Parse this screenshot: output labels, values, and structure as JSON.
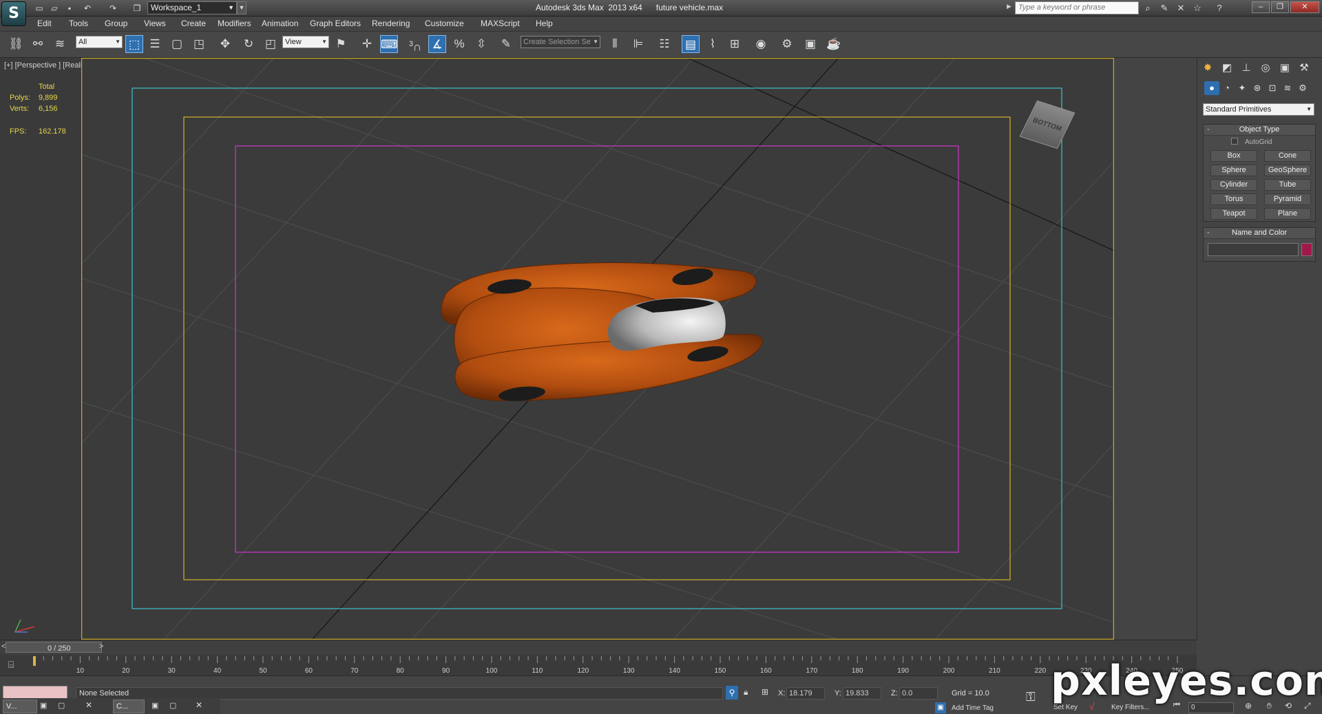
{
  "titlebar": {
    "workspace": "Workspace_1",
    "app_title": "Autodesk 3ds Max  2013 x64",
    "file_name": "future vehicle.max",
    "search_placeholder": "Type a keyword or phrase"
  },
  "menu": [
    "Edit",
    "Tools",
    "Group",
    "Views",
    "Create",
    "Modifiers",
    "Animation",
    "Graph Editors",
    "Rendering",
    "Customize",
    "MAXScript",
    "Help"
  ],
  "toolbar": {
    "selection_filter": "All",
    "reference_coord": "View",
    "named_selection": "Create Selection Se",
    "snap_3d": "3"
  },
  "viewport": {
    "label": "[+] [Perspective ] [Realistic ]",
    "stats": {
      "header": "Total",
      "polys_label": "Polys:",
      "polys": "9,899",
      "verts_label": "Verts:",
      "verts": "6,156",
      "fps_label": "FPS:",
      "fps": "162.178"
    },
    "viewcube_label": "BOTTOM",
    "colors": {
      "safe_outer": "#c7a92a",
      "safe_action": "#3fb7c4",
      "safe_title": "#c7a92a",
      "safe_inner": "#c238c4",
      "vehicle": "#c25812"
    }
  },
  "command_panel": {
    "category": "Standard Primitives",
    "object_type_title": "Object Type",
    "autogrid": "AutoGrid",
    "primitives": [
      "Box",
      "Cone",
      "Sphere",
      "GeoSphere",
      "Cylinder",
      "Tube",
      "Torus",
      "Pyramid",
      "Teapot",
      "Plane"
    ],
    "name_color_title": "Name and Color",
    "color": "#a0184a"
  },
  "timeline": {
    "frame_counter": "0 / 250",
    "ticks": [
      "10",
      "20",
      "30",
      "40",
      "50",
      "60",
      "70",
      "80",
      "90",
      "100",
      "110",
      "120",
      "130",
      "140",
      "150",
      "160",
      "170",
      "180",
      "190",
      "200",
      "210",
      "220",
      "230",
      "240",
      "250"
    ]
  },
  "status": {
    "text": "None Selected",
    "x_label": "X:",
    "x": "18.179",
    "y_label": "Y:",
    "y": "19.833",
    "z_label": "Z:",
    "z": "0.0",
    "grid": "Grid = 10.0",
    "add_time_tag": "Add Time Tag",
    "set_key": "Set Key",
    "key_filters": "Key Filters...",
    "frame": "0"
  },
  "taskbar": {
    "task1": "V...",
    "task2": "C..."
  },
  "watermark": "pxleyes.com"
}
